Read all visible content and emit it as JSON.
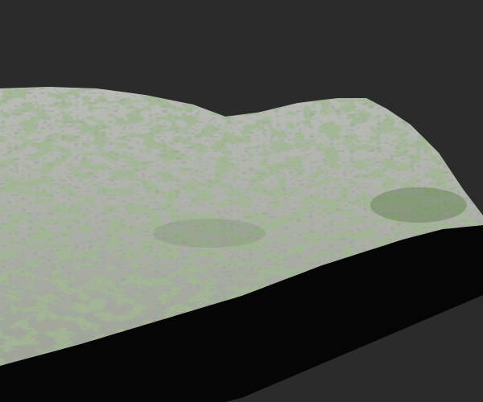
{
  "scene": {
    "subject": "terrain-render",
    "colors": {
      "background": "#2b2b2b",
      "terrain_side": "#050505",
      "rock": "#c9cbc6",
      "vegetation": "#5f7a4c"
    }
  }
}
